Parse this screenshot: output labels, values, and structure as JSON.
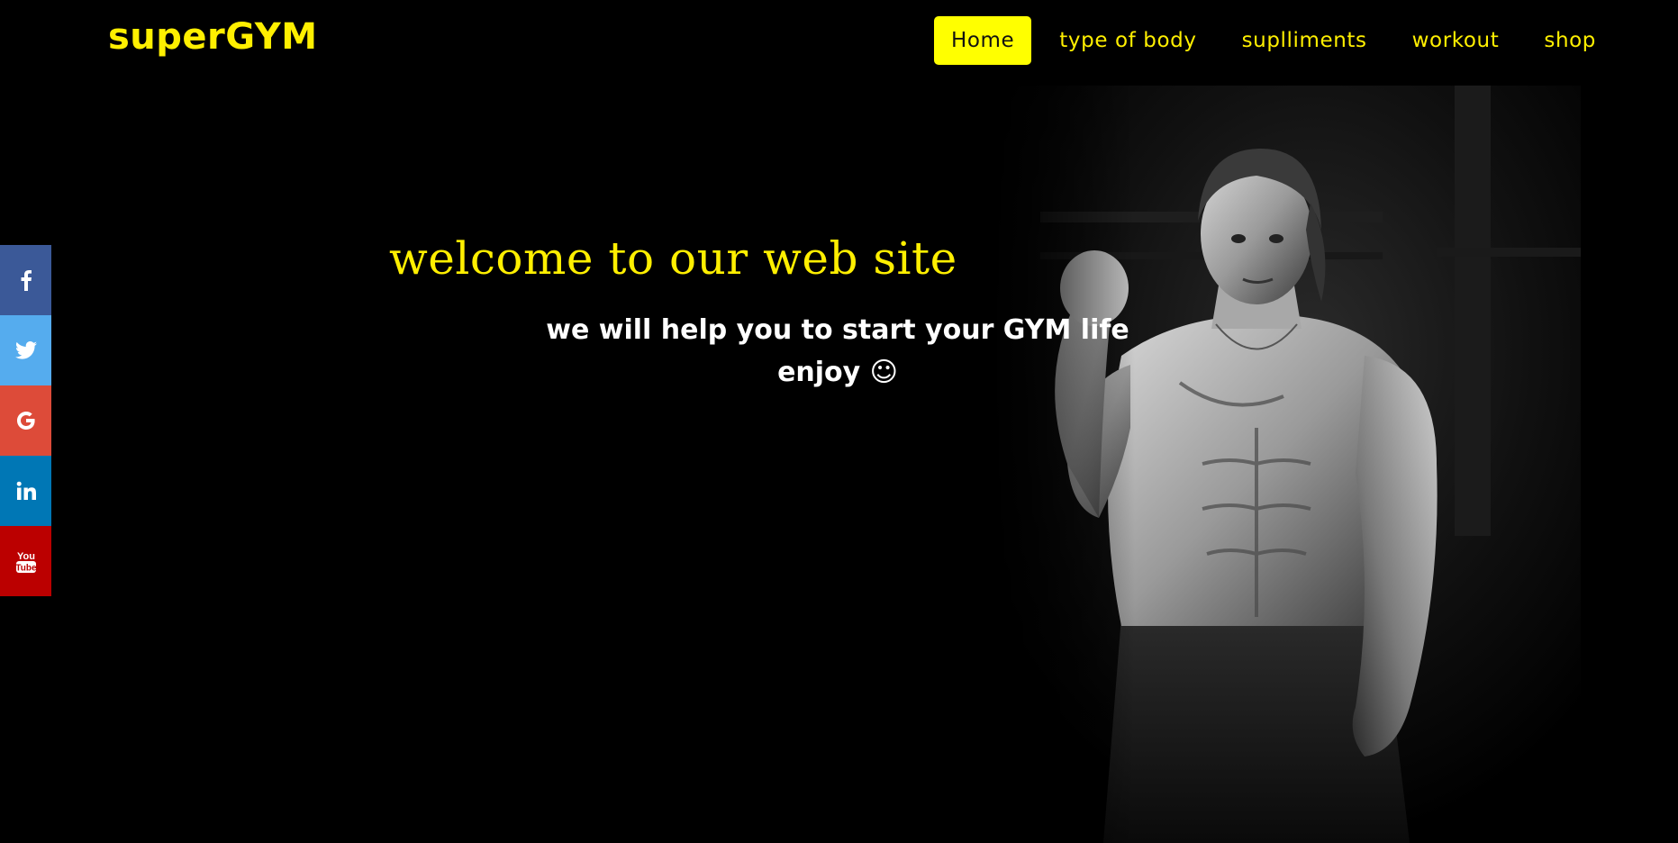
{
  "brand": {
    "logo_text": "superGYM",
    "accent_color": "#ffef00",
    "active_nav_bg": "#ffff00"
  },
  "nav": {
    "items": [
      {
        "label": "Home",
        "active": true
      },
      {
        "label": "type of body",
        "active": false
      },
      {
        "label": "suplliments",
        "active": false
      },
      {
        "label": "workout",
        "active": false
      },
      {
        "label": "shop",
        "active": false
      }
    ]
  },
  "hero": {
    "welcome": "welcome to our web site",
    "tagline_line1": "we will help you to start your GYM life",
    "tagline_line2": "enjoy ☺"
  },
  "social": [
    {
      "icon": "facebook-icon",
      "color": "#3b5998"
    },
    {
      "icon": "twitter-icon",
      "color": "#55acee"
    },
    {
      "icon": "google-icon",
      "color": "#dd4b39"
    },
    {
      "icon": "linkedin-icon",
      "color": "#0077b5"
    },
    {
      "icon": "youtube-icon",
      "color": "#bb0000"
    }
  ]
}
